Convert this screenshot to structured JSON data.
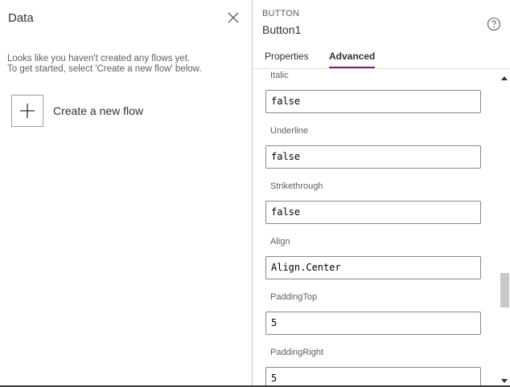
{
  "data_pane": {
    "title": "Data",
    "empty_line1": "Looks like you haven't created any flows yet.",
    "empty_line2": "To get started, select 'Create a new flow' below.",
    "create_flow_label": "Create a new flow",
    "icons": {
      "close": "close-icon",
      "plus": "plus-icon"
    }
  },
  "props_pane": {
    "control_type": "BUTTON",
    "control_name": "Button1",
    "tabs": [
      {
        "label": "Properties",
        "active": false
      },
      {
        "label": "Advanced",
        "active": true
      }
    ],
    "accent_color": "#742774",
    "properties": [
      {
        "label": "Italic",
        "value": "false"
      },
      {
        "label": "Underline",
        "value": "false"
      },
      {
        "label": "Strikethrough",
        "value": "false"
      },
      {
        "label": "Align",
        "value": "Align.Center"
      },
      {
        "label": "PaddingTop",
        "value": "5"
      },
      {
        "label": "PaddingRight",
        "value": "5"
      }
    ],
    "icons": {
      "help": "help-icon",
      "scroll_up": "scroll-up-icon",
      "scroll_down": "scroll-down-icon"
    }
  }
}
